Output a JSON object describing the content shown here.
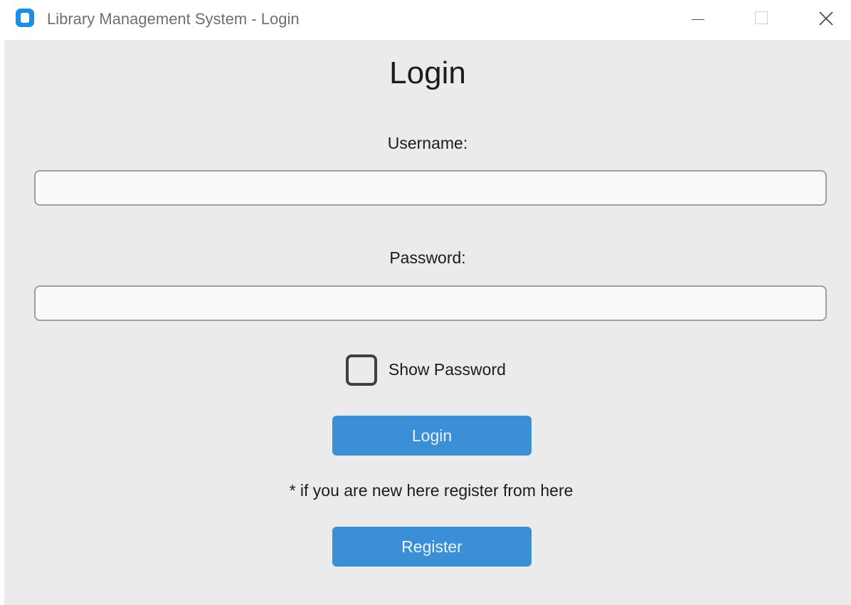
{
  "window": {
    "title": "Library Management System - Login"
  },
  "form": {
    "heading": "Login",
    "username_label": "Username:",
    "username_value": "",
    "password_label": "Password:",
    "password_value": "",
    "show_password_label": "Show Password",
    "show_password_checked": false,
    "login_button": "Login",
    "register_note": "* if you are new here register from here",
    "register_button": "Register"
  },
  "colors": {
    "accent": "#3a8fd6",
    "background": "#ebebeb",
    "field_border": "#9aa0a6"
  },
  "icons": {
    "app": "app-icon",
    "minimize": "minimize-icon",
    "maximize": "maximize-icon",
    "close": "close-icon"
  }
}
